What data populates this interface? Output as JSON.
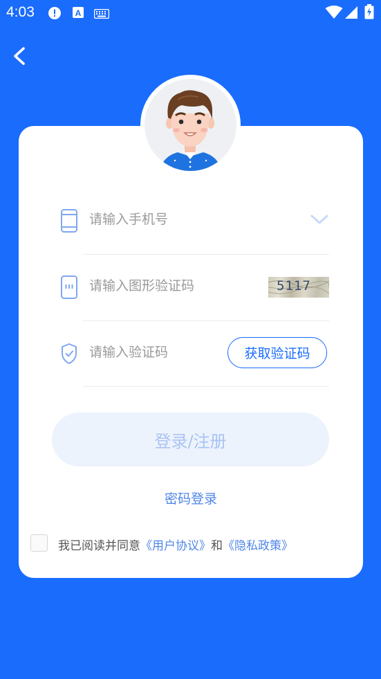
{
  "status_bar": {
    "time": "4:03",
    "icons": [
      "alert-icon",
      "font-a-icon",
      "keyboard-icon",
      "wifi-icon",
      "signal-icon",
      "battery-icon"
    ]
  },
  "nav": {
    "back_icon": "chevron-left-icon"
  },
  "avatar": {
    "icon": "user-avatar-illustration"
  },
  "form": {
    "phone": {
      "placeholder": "请输入手机号",
      "value": ""
    },
    "captcha": {
      "placeholder": "请输入图形验证码",
      "value": "",
      "image_text": "5117"
    },
    "code": {
      "placeholder": "请输入验证码",
      "value": "",
      "button_label": "获取验证码"
    }
  },
  "login_button": "登录/注册",
  "password_login": "密码登录",
  "agreement": {
    "checked": false,
    "prefix": "我已阅读并同意",
    "user_agreement": "《用户协议》",
    "and": "和",
    "privacy_policy": "《隐私政策》"
  },
  "colors": {
    "brand_blue": "#1a6cfc",
    "link_blue": "#4f86e9",
    "disabled_button_bg": "#edf3fd",
    "disabled_button_text": "#a9c3f2"
  }
}
